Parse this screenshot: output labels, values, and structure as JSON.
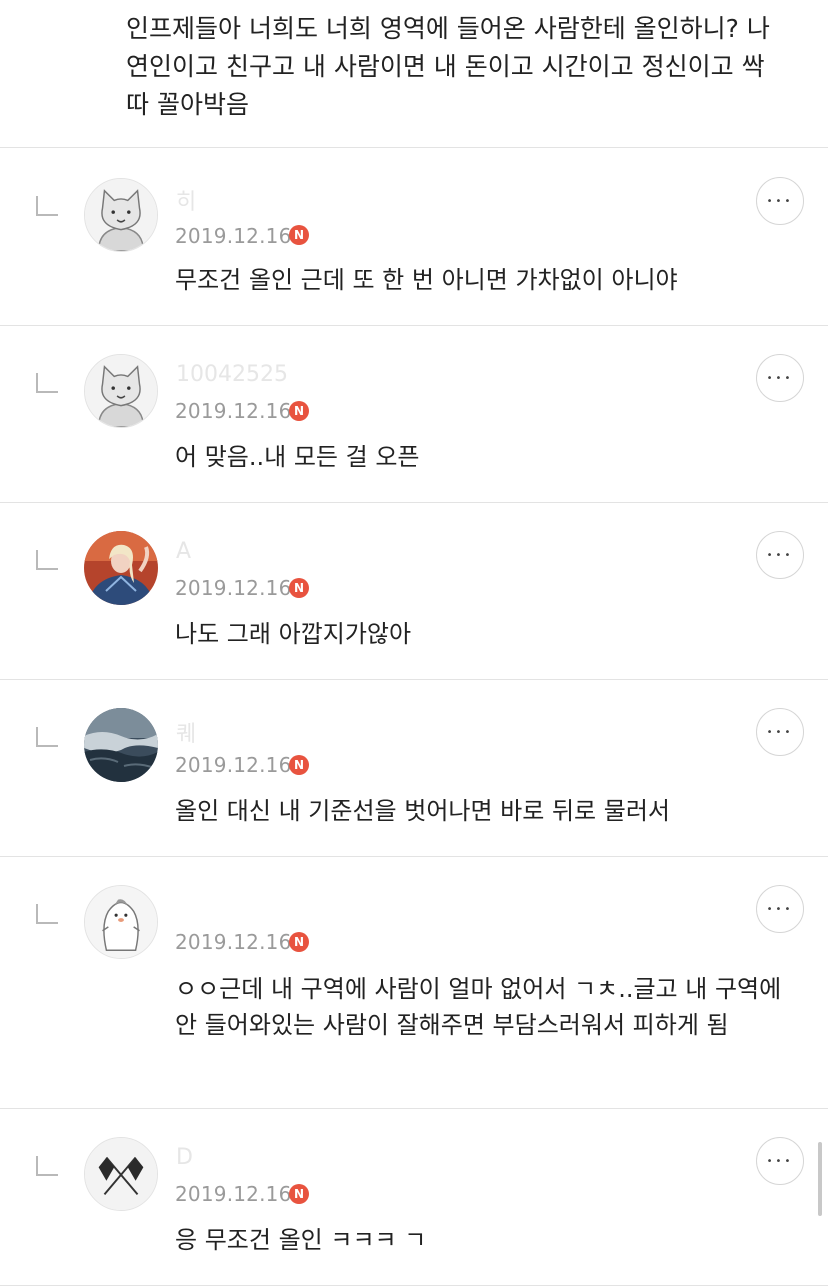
{
  "post": {
    "text": "인프제들아 너희도 너희 영역에 들어온 사람한테 올인하니? 나 연인이고 친구고 내 사람이면 내 돈이고 시간이고 정신이고 싹 따 꼴아박음"
  },
  "comments": [
    {
      "nickname": "히",
      "date": "2019.12.16",
      "badge": "N",
      "text": "무조건 올인 근데 또 한 번 아니면 가차없이 아니야",
      "avatar_icon": "cat-avatar-icon"
    },
    {
      "nickname": "10042525",
      "date": "2019.12.16",
      "badge": "N",
      "text": "어 맞음..내 모든 걸 오픈",
      "avatar_icon": "cat-avatar-icon"
    },
    {
      "nickname": "A",
      "date": "2019.12.16",
      "badge": "N",
      "text": "나도 그래 아깝지가않아",
      "avatar_icon": "princess-photo-icon"
    },
    {
      "nickname": "퀘",
      "date": "2019.12.16",
      "badge": "N",
      "text": "올인 대신 내 기준선을 벗어나면 바로 뒤로 물러서",
      "avatar_icon": "ocean-photo-icon"
    },
    {
      "nickname": "",
      "date": "2019.12.16",
      "badge": "N",
      "text": "ㅇㅇ근데 내 구역에 사람이 얼마 없어서 ㄱㅊ..글고 내 구역에 안 들어와있는 사람이 잘해주면 부담스러워서 피하게 됨",
      "avatar_icon": "penguin-avatar-icon"
    },
    {
      "nickname": "D",
      "date": "2019.12.16",
      "badge": "N",
      "text": "응 무조건 올인 ㅋㅋㅋ ㄱ",
      "avatar_icon": "crossed-flags-icon"
    }
  ],
  "more_label": "•••",
  "colors": {
    "badge": "#e8533f",
    "divider": "#e3e3e3",
    "date": "#9a9a9a"
  }
}
